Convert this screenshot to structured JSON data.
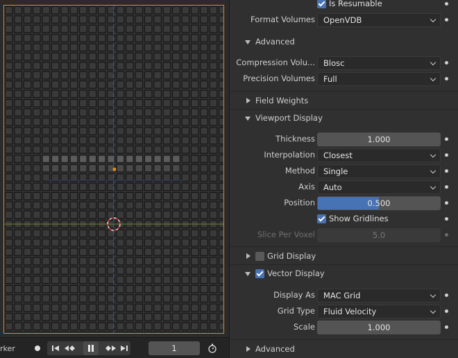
{
  "viewport": {
    "timeline": {
      "marker_label": "rker",
      "current_frame": "1"
    }
  },
  "panel": {
    "is_resumable": {
      "label": "Is Resumable",
      "checked": true
    },
    "format_volumes": {
      "label": "Format Volumes",
      "value": "OpenVDB"
    },
    "advanced_section": {
      "label": "Advanced"
    },
    "compression_volumes": {
      "label": "Compression Volu...",
      "value": "Blosc"
    },
    "precision_volumes": {
      "label": "Precision Volumes",
      "value": "Full"
    },
    "field_weights_section": {
      "label": "Field Weights"
    },
    "viewport_display_section": {
      "label": "Viewport Display"
    },
    "thickness": {
      "label": "Thickness",
      "value": "1.000"
    },
    "interpolation": {
      "label": "Interpolation",
      "value": "Closest"
    },
    "method": {
      "label": "Method",
      "value": "Single"
    },
    "axis": {
      "label": "Axis",
      "value": "Auto"
    },
    "position": {
      "label": "Position",
      "value": "0.500",
      "fraction": 0.5
    },
    "show_gridlines": {
      "label": "Show Gridlines",
      "checked": true
    },
    "slice_per_voxel": {
      "label": "Slice Per Voxel",
      "value": "5.0"
    },
    "grid_display_section": {
      "label": "Grid Display",
      "checked": false
    },
    "vector_display_section": {
      "label": "Vector Display",
      "checked": true
    },
    "display_as": {
      "label": "Display As",
      "value": "MAC Grid"
    },
    "grid_type": {
      "label": "Grid Type",
      "value": "Fluid Velocity"
    },
    "scale": {
      "label": "Scale",
      "value": "1.000"
    },
    "advanced_section_2": {
      "label": "Advanced"
    }
  },
  "colors": {
    "accent": "#4772b3",
    "active_outline": "#d8862a",
    "axis_x": "#7a9a2a",
    "axis_y": "#3d5f8f"
  }
}
